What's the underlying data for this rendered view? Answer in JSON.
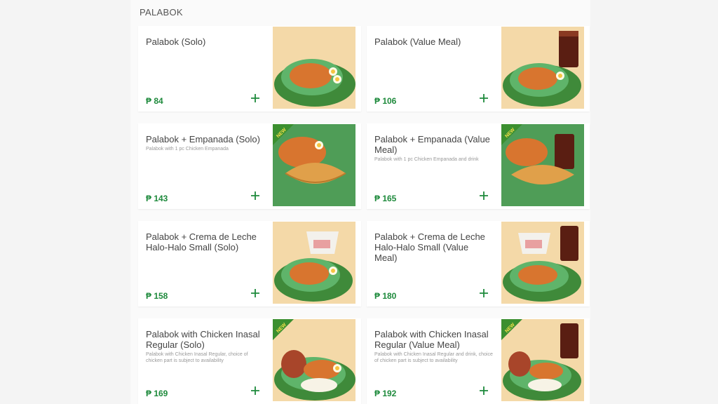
{
  "section": {
    "title": "PALABOK"
  },
  "currency_symbol": "₱",
  "colors": {
    "price": "#1e8a3c",
    "add_icon": "#1e8a3c",
    "new_badge": "#3b8f2f",
    "leaf": "#3f8a3a"
  },
  "items": [
    {
      "name": "Palabok (Solo)",
      "description": "",
      "price": "₱ 84",
      "new": false,
      "image": "palabok-plate"
    },
    {
      "name": "Palabok (Value Meal)",
      "description": "",
      "price": "₱ 106",
      "new": false,
      "image": "palabok-plate-with-drink"
    },
    {
      "name": "Palabok + Empanada (Solo)",
      "description": "Palabok with 1 pc Chicken Empanada",
      "price": "₱ 143",
      "new": true,
      "image": "palabok-empanada"
    },
    {
      "name": "Palabok + Empanada (Value Meal)",
      "description": "Palabok with 1 pc Chicken Empanada and drink",
      "price": "₱ 165",
      "new": true,
      "image": "palabok-empanada-with-drink"
    },
    {
      "name": "Palabok + Crema de Leche Halo-Halo Small (Solo)",
      "description": "",
      "price": "₱ 158",
      "new": false,
      "image": "palabok-halo-halo"
    },
    {
      "name": "Palabok + Crema de Leche Halo-Halo Small (Value Meal)",
      "description": "",
      "price": "₱ 180",
      "new": false,
      "image": "palabok-halo-halo-with-drink"
    },
    {
      "name": "Palabok with Chicken Inasal Regular (Solo)",
      "description": "Palabok with Chicken Inasal Regular, choice of chicken part is subject to availability",
      "price": "₱ 169",
      "new": true,
      "image": "palabok-chicken-inasal"
    },
    {
      "name": "Palabok with Chicken Inasal Regular (Value Meal)",
      "description": "Palabok with Chicken Inasal Regular and drink, choice of chicken part is subject to availability",
      "price": "₱ 192",
      "new": true,
      "image": "palabok-chicken-inasal-with-drink"
    }
  ],
  "badge": {
    "new_label": "NEW"
  },
  "icons": {
    "add": "plus-icon"
  }
}
